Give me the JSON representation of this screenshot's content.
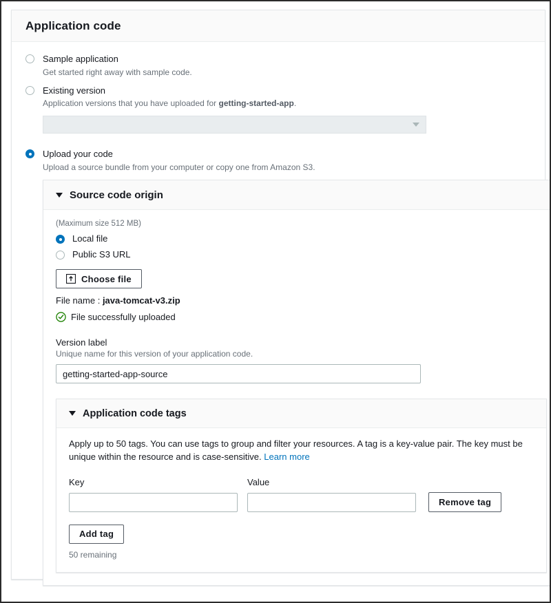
{
  "panel": {
    "title": "Application code"
  },
  "code_source_options": [
    {
      "id": "sample-application",
      "label": "Sample application",
      "description": "Get started right away with sample code.",
      "selected": false
    },
    {
      "id": "existing-version",
      "label": "Existing version",
      "description_before": "Application versions that you have uploaded for ",
      "description_strong": "getting-started-app",
      "description_after": ".",
      "selected": false
    },
    {
      "id": "upload-your-code",
      "label": "Upload your code",
      "description": "Upload a source bundle from your computer or copy one from Amazon S3.",
      "selected": true
    }
  ],
  "existing_version_select": {
    "value": "",
    "placeholder": "",
    "disabled": true,
    "caret_icon": "chevron-down-icon"
  },
  "source_code_origin": {
    "title": "Source code origin",
    "expand_icon": "caret-down-icon",
    "max_size_note": "(Maximum size 512 MB)",
    "origin_options": [
      {
        "id": "local-file",
        "label": "Local file",
        "selected": true
      },
      {
        "id": "public-s3-url",
        "label": "Public S3 URL",
        "selected": false
      }
    ],
    "choose_file": {
      "label": "Choose file",
      "icon": "upload-icon"
    },
    "file_name_label": "File name :",
    "file_name_value": "java-tomcat-v3.zip",
    "upload_status": {
      "icon": "success-check-circle-icon",
      "text": "File successfully uploaded",
      "color": "#1d8102"
    },
    "version_label": {
      "label": "Version label",
      "hint": "Unique name for this version of your application code.",
      "value": "getting-started-app-source",
      "placeholder": ""
    }
  },
  "application_code_tags": {
    "title": "Application code tags",
    "expand_icon": "caret-down-icon",
    "description_part1": "Apply up to 50 tags. You can use tags to group and filter your resources. A tag is a key-value pair. The key must be unique within the resource and is case-sensitive.",
    "learn_more_label": "Learn more",
    "key_label": "Key",
    "key_value": "",
    "key_placeholder": "",
    "value_label": "Value",
    "value_value": "",
    "value_placeholder": "",
    "remove_tag_label": "Remove tag",
    "add_tag_label": "Add tag",
    "remaining_text": "50 remaining"
  },
  "colors": {
    "accent": "#0073bb",
    "link": "#0073bb",
    "success": "#1d8102",
    "border": "#e3e6e8",
    "header_bg": "#fafafa",
    "text": "#16191f",
    "muted": "#687078"
  }
}
